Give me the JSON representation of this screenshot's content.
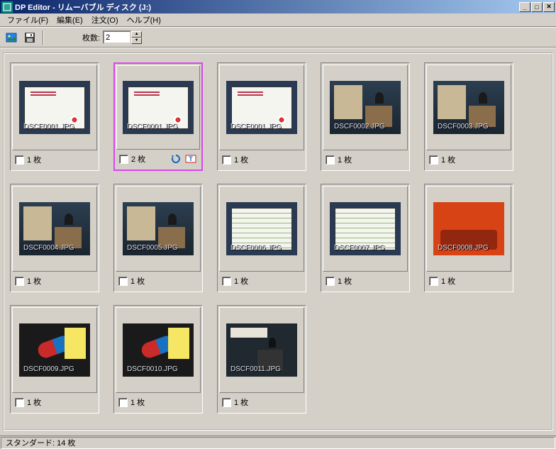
{
  "window": {
    "title": "DP Editor - リムーバブル ディスク (J:)"
  },
  "menu": {
    "file": "ファイル(F)",
    "edit": "編集(E)",
    "order": "注文(O)",
    "help": "ヘルプ(H)"
  },
  "toolbar": {
    "count_label": "枚数:",
    "count_value": "2"
  },
  "suffix": " 枚",
  "thumbs": [
    {
      "file": "DSCF0001.JPG",
      "count": "1",
      "selected": false,
      "art": "slide-white",
      "icons": false
    },
    {
      "file": "DSCF0001.JPG",
      "count": "2",
      "selected": true,
      "art": "slide-white",
      "icons": true
    },
    {
      "file": "DSCF0001.JPG",
      "count": "1",
      "selected": false,
      "art": "slide-white",
      "icons": false
    },
    {
      "file": "DSCF0002.JPG",
      "count": "1",
      "selected": false,
      "art": "podium",
      "icons": false
    },
    {
      "file": "DSCF0003.JPG",
      "count": "1",
      "selected": false,
      "art": "podium",
      "icons": false
    },
    {
      "file": "DSCF0004.JPG",
      "count": "1",
      "selected": false,
      "art": "podium",
      "icons": false
    },
    {
      "file": "DSCF0005.JPG",
      "count": "1",
      "selected": false,
      "art": "podium",
      "icons": false
    },
    {
      "file": "DSCF0006.JPG",
      "count": "1",
      "selected": false,
      "art": "slide-lines",
      "icons": false
    },
    {
      "file": "DSCF0007.JPG",
      "count": "1",
      "selected": false,
      "art": "slide-lines",
      "icons": false
    },
    {
      "file": "DSCF0008.JPG",
      "count": "1",
      "selected": false,
      "art": "orange",
      "icons": false
    },
    {
      "file": "DSCF0009.JPG",
      "count": "1",
      "selected": false,
      "art": "pill",
      "icons": false
    },
    {
      "file": "DSCF0010.JPG",
      "count": "1",
      "selected": false,
      "art": "pill",
      "icons": false
    },
    {
      "file": "DSCF0011.JPG",
      "count": "1",
      "selected": false,
      "art": "podium2",
      "icons": false
    }
  ],
  "status": {
    "text": "スタンダード: 14 枚"
  }
}
